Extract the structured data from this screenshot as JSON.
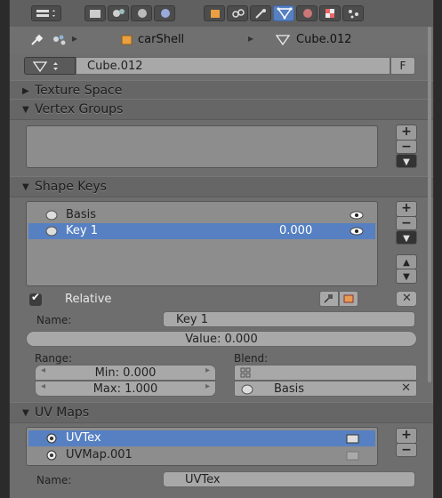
{
  "breadcrumb": {
    "object": "carShell",
    "mesh": "Cube.012"
  },
  "datablock": {
    "name": "Cube.012",
    "fake_user": "F"
  },
  "panels": {
    "texture_space": "Texture Space",
    "vertex_groups": "Vertex Groups",
    "shape_keys": "Shape Keys",
    "uv_maps": "UV Maps"
  },
  "shape_keys": {
    "items": [
      {
        "name": "Basis",
        "value": ""
      },
      {
        "name": "Key 1",
        "value": "0.000"
      }
    ],
    "relative_label": "Relative",
    "name_label": "Name:",
    "name_value": "Key 1",
    "value_slider": "Value: 0.000",
    "range_label": "Range:",
    "min": "Min: 0.000",
    "max": "Max: 1.000",
    "blend_label": "Blend:",
    "blend_shape": "Basis"
  },
  "uv_maps": {
    "items": [
      {
        "name": "UVTex"
      },
      {
        "name": "UVMap.001"
      }
    ],
    "name_label": "Name:",
    "name_value": "UVTex"
  },
  "icons": [
    "mesh-icon",
    "pin-icon",
    "object-icon",
    "cube-icon",
    "eye-icon",
    "plus-icon",
    "minus-icon",
    "chevron-down-icon",
    "arrow-up-icon",
    "arrow-down-icon",
    "check-icon",
    "close-icon",
    "uv-icon"
  ],
  "colors": {
    "selection": "#5680c2",
    "panel_bg": "#6e6e6e",
    "field": "#a8a8a8"
  }
}
